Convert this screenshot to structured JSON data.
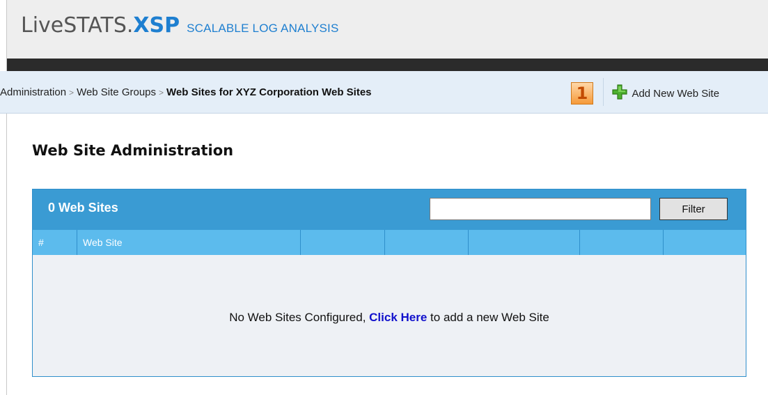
{
  "header": {
    "logo_main": "LiveSTATS.",
    "logo_accent": "XSP",
    "tagline": "SCALABLE LOG ANALYSIS"
  },
  "breadcrumb": {
    "items": [
      "Administration",
      "Web Site Groups"
    ],
    "separator": ">",
    "current": "Web Sites for XYZ Corporation Web Sites",
    "badge": "1"
  },
  "actions": {
    "add_new_label": "Add New Web Site"
  },
  "page": {
    "title": "Web Site Administration"
  },
  "panel": {
    "count_label": "0 Web Sites",
    "filter_value": "",
    "filter_button": "Filter",
    "columns": [
      "#",
      "Web Site",
      "",
      "",
      "",
      "",
      ""
    ],
    "empty_prefix": "No Web Sites Configured, ",
    "empty_link": "Click Here",
    "empty_suffix": " to add a new Web Site"
  },
  "colors": {
    "accent_blue": "#1e7fd0",
    "panel_header": "#3a9bd3",
    "column_header": "#5cbbed",
    "badge_orange": "#f59a3a"
  },
  "icons": {
    "add": "plus-icon"
  }
}
